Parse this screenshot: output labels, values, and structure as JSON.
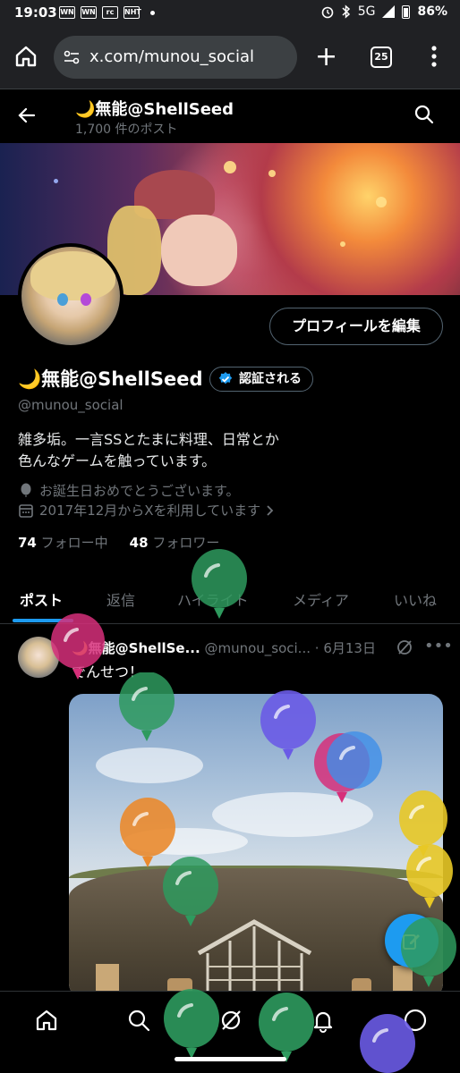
{
  "status_bar": {
    "time": "19:03",
    "notification_icons": [
      "WN",
      "WN",
      "rc",
      "NHT"
    ],
    "network": "5G",
    "battery": "86%"
  },
  "browser": {
    "url": "x.com/munou_social",
    "tab_count": "25"
  },
  "profile_header": {
    "display_name": "🌙無能@ShellSeed",
    "post_count": "1,700 件のポスト"
  },
  "profile": {
    "edit_button": "プロフィールを編集",
    "display_name": "🌙無能@ShellSeed",
    "verified_label": "認証される",
    "handle": "@munou_social",
    "bio_line1": "雑多垢。一言SSとたまに料理、日常とか",
    "bio_line2": "色んなゲームを触っています。",
    "birthday": "お誕生日おめでとうございます。",
    "joined": "2017年12月からXを利用しています",
    "following_count": "74",
    "following_label": "フォロー中",
    "followers_count": "48",
    "followers_label": "フォロワー"
  },
  "tabs": [
    {
      "label": "ポスト",
      "active": true
    },
    {
      "label": "返信",
      "active": false
    },
    {
      "label": "ハイライト",
      "active": false
    },
    {
      "label": "メディア",
      "active": false
    },
    {
      "label": "いいね",
      "active": false
    }
  ],
  "post": {
    "author": "🌙無能@ShellSe...",
    "handle": "@munou_soci...",
    "separator": "·",
    "date": "6月13日",
    "text": "でんせつ！"
  },
  "colors": {
    "accent": "#1d9bf0",
    "background": "#000000",
    "muted_text": "#71767b",
    "balloon_green": "#2e9a5e",
    "balloon_purple": "#6a5be6",
    "balloon_pink": "#d62f7a",
    "balloon_yellow": "#e8c826",
    "balloon_orange": "#ea8a2e",
    "balloon_blue": "#3f8ee8"
  },
  "icons": {
    "browser": [
      "home-icon",
      "site-settings-icon",
      "new-tab-icon",
      "tab-switcher-icon",
      "more-vert-icon"
    ],
    "profile": [
      "back-arrow-icon",
      "search-icon",
      "verified-badge-icon",
      "balloon-icon",
      "calendar-icon"
    ],
    "bottom_nav": [
      "home-icon",
      "search-icon",
      "grok-icon",
      "notifications-icon",
      "messages-icon"
    ],
    "fab": "compose-icon"
  }
}
